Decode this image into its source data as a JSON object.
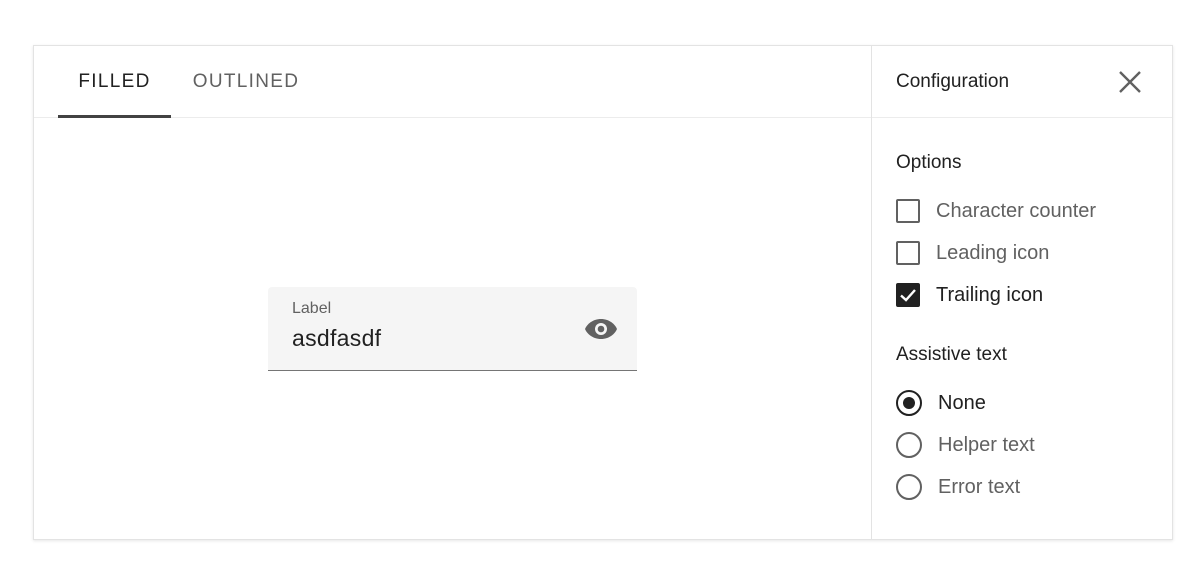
{
  "tabs": [
    {
      "label": "FILLED",
      "active": true
    },
    {
      "label": "OUTLINED",
      "active": false
    }
  ],
  "field": {
    "label": "Label",
    "value": "asdfasdf",
    "trailing_icon": "eye-icon"
  },
  "config": {
    "title": "Configuration",
    "close_icon": "close-icon",
    "options_title": "Options",
    "options": [
      {
        "label": "Character counter",
        "checked": false
      },
      {
        "label": "Leading icon",
        "checked": false
      },
      {
        "label": "Trailing icon",
        "checked": true
      }
    ],
    "assistive_title": "Assistive text",
    "assistive": [
      {
        "label": "None",
        "selected": true
      },
      {
        "label": "Helper text",
        "selected": false
      },
      {
        "label": "Error text",
        "selected": false
      }
    ]
  },
  "colors": {
    "text_primary": "#212121",
    "text_secondary": "#616161",
    "field_bg": "#f5f5f5"
  }
}
